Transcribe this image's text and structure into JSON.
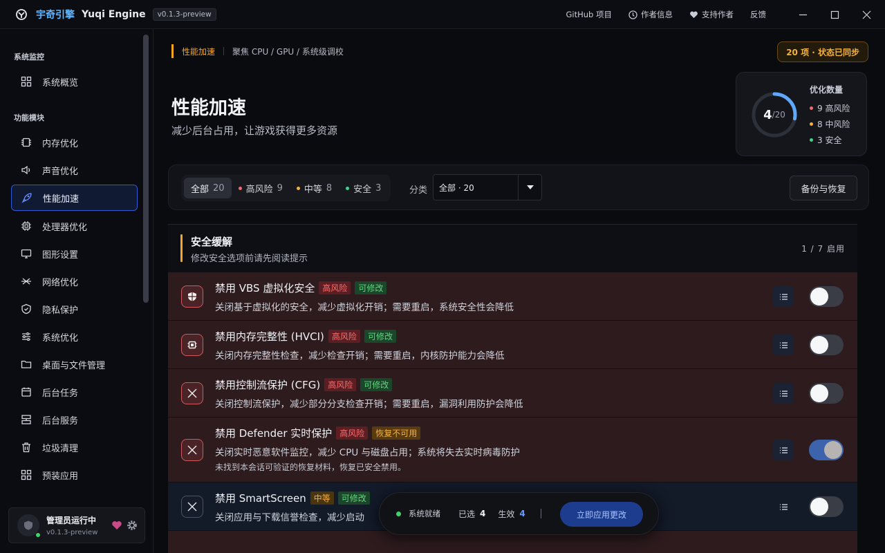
{
  "titlebar": {
    "app_name_cn": "宇奇引擎",
    "app_name_en": "Yuqi Engine",
    "version": "v0.1.3-preview",
    "links": [
      "GitHub 项目",
      "作者信息",
      "支持作者",
      "反馈"
    ]
  },
  "sidebar": {
    "section_monitor": "系统监控",
    "section_modules": "功能模块",
    "items": [
      {
        "label": "系统概览",
        "icon": "grid-icon"
      },
      {
        "label": "内存优化",
        "icon": "memory-chip-icon"
      },
      {
        "label": "声音优化",
        "icon": "speaker-icon"
      },
      {
        "label": "性能加速",
        "icon": "rocket-icon"
      },
      {
        "label": "处理器优化",
        "icon": "cpu-icon"
      },
      {
        "label": "图形设置",
        "icon": "monitor-icon"
      },
      {
        "label": "网络优化",
        "icon": "network-icon"
      },
      {
        "label": "隐私保护",
        "icon": "shield-icon"
      },
      {
        "label": "系统优化",
        "icon": "sliders-icon"
      },
      {
        "label": "桌面与文件管理",
        "icon": "folder-icon"
      },
      {
        "label": "后台任务",
        "icon": "calendar-icon"
      },
      {
        "label": "后台服务",
        "icon": "server-icon"
      },
      {
        "label": "垃圾清理",
        "icon": "trash-icon"
      },
      {
        "label": "预装应用",
        "icon": "apps-icon"
      }
    ],
    "active_index": 3,
    "footer": {
      "user": "管理员运行中",
      "version": "v0.1.3-preview"
    }
  },
  "page": {
    "breadcrumb_current": "性能加速",
    "breadcrumb_path": "聚焦 CPU / GPU / 系统级调校",
    "sync_badge": "20 项 · 状态已同步",
    "title": "性能加速",
    "subtitle": "减少后台占用，让游戏获得更多资源"
  },
  "stats": {
    "title": "优化数量",
    "enabled": 4,
    "total_text": "/20",
    "total": 20,
    "high": "9 高风险",
    "mid": "8 中风险",
    "safe": "3 安全",
    "colors": {
      "ring": "#5fa8ff",
      "high": "#f26b6b",
      "mid": "#f5b13c",
      "safe": "#3fd38a"
    }
  },
  "filters": {
    "all": "全部",
    "all_count": "20",
    "high": "高风险",
    "high_count": "9",
    "mid": "中等",
    "mid_count": "8",
    "safe": "安全",
    "safe_count": "3",
    "category_label": "分类",
    "category_value": "全部 · 20",
    "backup_button": "备份与恢复"
  },
  "section": {
    "title": "安全缓解",
    "subtitle": "修改安全选项前请先阅读提示",
    "count": "1 / 7 启用"
  },
  "rows": [
    {
      "title": "禁用 VBS 虚拟化安全",
      "risk": "高风险",
      "status": "可修改",
      "desc": "关闭基于虚拟化的安全，减少虚拟化开销；需要重启，系统安全性会降低",
      "enabled": false
    },
    {
      "title": "禁用内存完整性 (HVCI)",
      "risk": "高风险",
      "status": "可修改",
      "desc": "关闭内存完整性检查，减少检查开销；需要重启，内核防护能力会降低",
      "enabled": false
    },
    {
      "title": "禁用控制流保护 (CFG)",
      "risk": "高风险",
      "status": "可修改",
      "desc": "关闭控制流保护，减少部分分支检查开销；需要重启，漏洞利用防护会降低",
      "enabled": false
    },
    {
      "title": "禁用 Defender 实时保护",
      "risk": "高风险",
      "status": "恢复不可用",
      "desc": "关闭实时恶意软件监控，减少 CPU 与磁盘占用；系统将失去实时病毒防护",
      "note": "未找到本会话可验证的恢复材料，恢复已安全禁用。",
      "enabled": true
    },
    {
      "title": "禁用 SmartScreen",
      "risk": "中等",
      "status": "可修改",
      "desc": "关闭应用与下载信誉检查，减少启动",
      "enabled": false
    }
  ],
  "action_bar": {
    "status": "系统就绪",
    "selected_label": "已选",
    "selected": "4",
    "effective_label": "生效",
    "effective": "4",
    "apply_button": "立即应用更改"
  }
}
